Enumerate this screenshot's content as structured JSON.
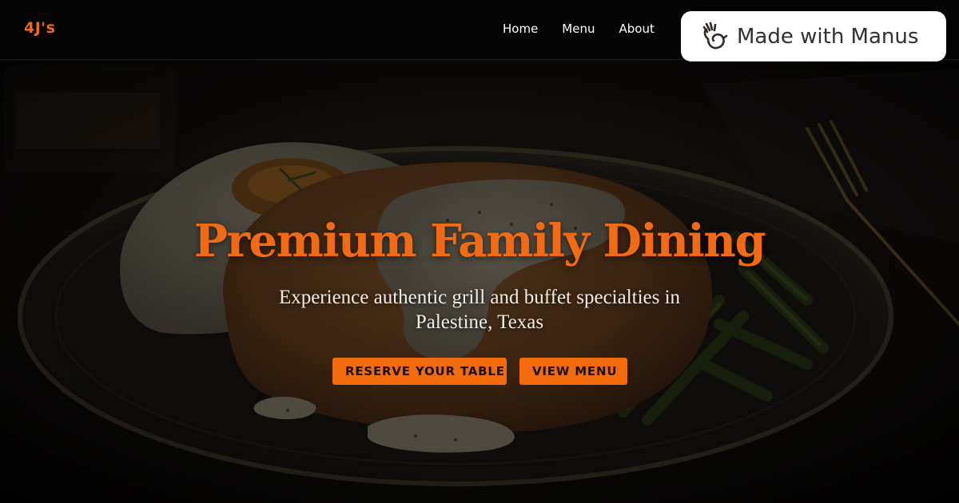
{
  "brand": {
    "logo": "4J's",
    "accent_color": "#f26b14"
  },
  "nav": {
    "items": [
      {
        "label": "Home"
      },
      {
        "label": "Menu"
      },
      {
        "label": "About"
      }
    ]
  },
  "badge": {
    "text": "Made with Manus",
    "icon": "manus-hand-icon"
  },
  "hero": {
    "title": "Premium Family Dining",
    "subtitle": "Experience authentic grill and buffet specialties in Palestine, Texas",
    "buttons": {
      "reserve": "RESERVE YOUR TABLE",
      "menu": "VIEW MENU"
    },
    "image": "chicken-fried-steak-with-gravy-mashed-potatoes-green-beans"
  }
}
